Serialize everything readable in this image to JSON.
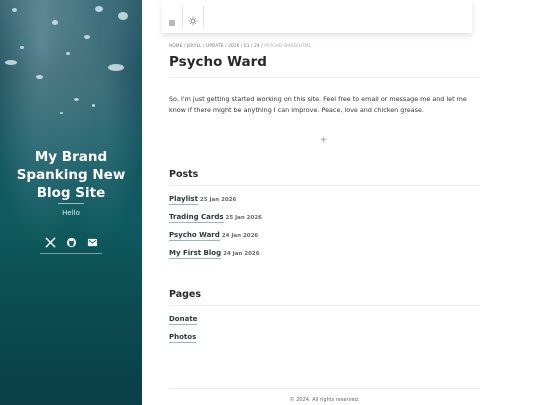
{
  "sidebar": {
    "brand_line1": "My Brand",
    "brand_line2": "Spanking New",
    "brand_line3": "Blog Site",
    "tagline": "Hello",
    "social_icons": [
      "x-icon",
      "github-icon",
      "email-icon"
    ]
  },
  "topbar": {
    "menu_icon": "menu-icon",
    "theme_icon": "sun-icon"
  },
  "breadcrumb": {
    "items": [
      "HOME",
      "JEKYLL",
      "UPDATE",
      "2026",
      "01",
      "24"
    ],
    "current": "PSYCHO WARD.HTML"
  },
  "page": {
    "title": "Psycho Ward",
    "body": "So, I'm just getting started working on this site. Feel free to email or message me and let me know if there might be anything I can improve. Peace, love and chicken grease."
  },
  "posts": {
    "heading": "Posts",
    "items": [
      {
        "title": "Playlist",
        "date": "25 Jan 2026"
      },
      {
        "title": "Trading Cards",
        "date": "25 Jan 2026"
      },
      {
        "title": "Psycho Ward",
        "date": "24 Jan 2026"
      },
      {
        "title": "My First Blog",
        "date": "24 Jan 2026"
      }
    ]
  },
  "pages": {
    "heading": "Pages",
    "items": [
      {
        "title": "Donate"
      },
      {
        "title": "Photos"
      }
    ]
  },
  "footer": {
    "text": "© 2024. All rights reserved."
  },
  "colors": {
    "sidebar_top": "#2f5f6e",
    "sidebar_bottom": "#0a3f47",
    "link_underline": "#9bb7b7"
  }
}
